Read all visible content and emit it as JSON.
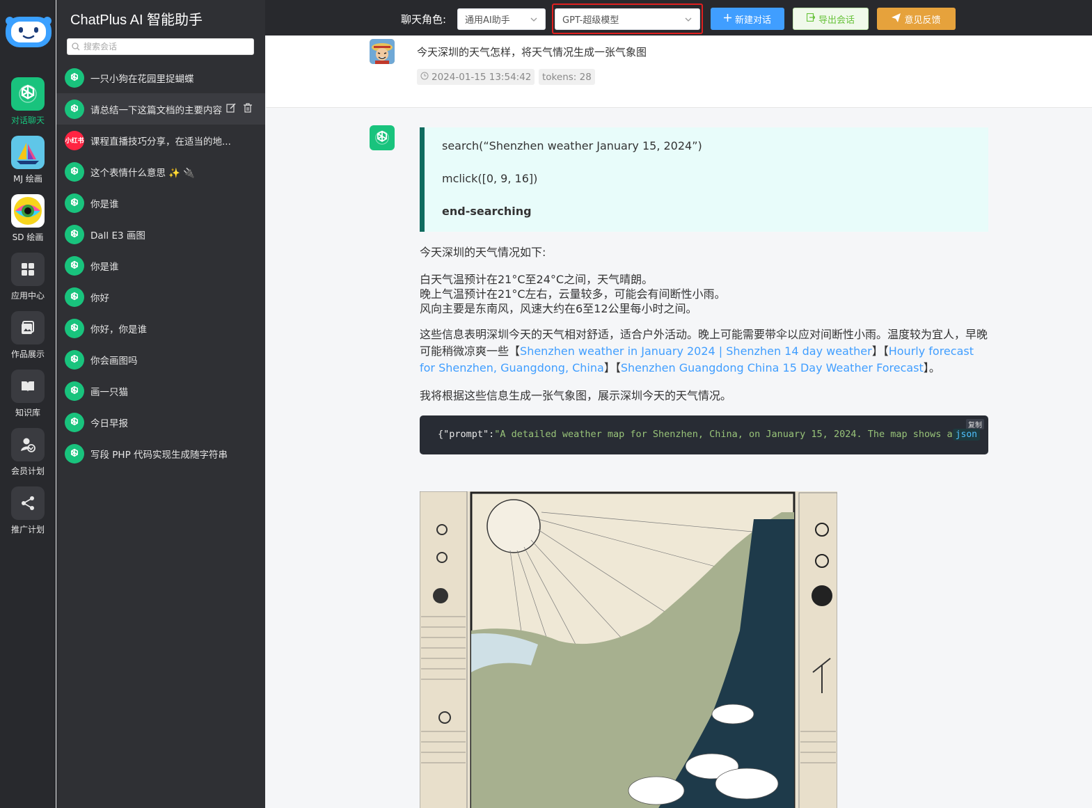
{
  "app": {
    "title": "ChatPlus AI 智能助手"
  },
  "rail": {
    "items": [
      {
        "label": "对话聊天",
        "icon": "openai-icon"
      },
      {
        "label": "MJ 绘画",
        "icon": "sailboat-icon"
      },
      {
        "label": "SD 绘画",
        "icon": "eye-art-icon"
      },
      {
        "label": "应用中心",
        "icon": "grid-icon"
      },
      {
        "label": "作品展示",
        "icon": "gallery-icon"
      },
      {
        "label": "知识库",
        "icon": "book-icon"
      },
      {
        "label": "会员计划",
        "icon": "member-icon"
      },
      {
        "label": "推广计划",
        "icon": "share-icon"
      }
    ]
  },
  "search": {
    "placeholder": "搜索会话"
  },
  "conversations": [
    {
      "title": "一只小狗在花园里捉蝴蝶"
    },
    {
      "title": "请总结一下这篇文档的主要内容",
      "active": true
    },
    {
      "title": "课程直播技巧分享，在适当的地...",
      "icon_text": "小红书"
    },
    {
      "title": "这个表情什么意思 ✨ 🔌"
    },
    {
      "title": "你是谁"
    },
    {
      "title": "Dall E3 画图"
    },
    {
      "title": "你是谁"
    },
    {
      "title": "你好"
    },
    {
      "title": "你好，你是谁"
    },
    {
      "title": "你会画图吗"
    },
    {
      "title": "画一只猫"
    },
    {
      "title": "今日早报"
    },
    {
      "title": "写段 PHP 代码实现生成随字符串"
    }
  ],
  "topbar": {
    "role_label": "聊天角色:",
    "role_value": "通用AI助手",
    "model_value": "GPT-超级模型",
    "new_chat": "新建对话",
    "export": "导出会话",
    "feedback": "意见反馈"
  },
  "message_user": {
    "text": "今天深圳的天气怎样，将天气情况生成一张气象图",
    "time": "2024-01-15 13:54:42",
    "tokens": "tokens: 28"
  },
  "message_ai": {
    "quote": [
      "search(“Shenzhen weather January 15, 2024”)",
      "mclick([0, 9, 16])",
      "end-searching"
    ],
    "intro": "今天深圳的天气情况如下:",
    "lines": [
      "白天气温预计在21°C至24°C之间，天气晴朗。",
      "晚上气温预计在21°C左右，云量较多，可能会有间断性小雨。",
      "风向主要是东南风，风速大约在6至12公里每小时之间。"
    ],
    "summary_text": "这些信息表明深圳今天的天气相对舒适，适合户外活动。晚上可能需要带伞以应对间断性小雨。温度较为宜人，早晚可能稍微凉爽一些",
    "link1": "Shenzhen weather in January 2024 | Shenzhen 14 day weather",
    "link2": "Hourly forecast for Shenzhen, Guangdong, China",
    "link3": "Shenzhen Guangdong China 15 Day Weather Forecast",
    "bracket_open": "【",
    "bracket_close": "】",
    "end_mark": "。",
    "plan": "我将根据这些信息生成一张气象图，展示深圳今天的天气情况。",
    "code_prefix": "{\"prompt\":",
    "code_string": "\"A detailed weather map for Shenzhen, China, on January 15, 2024. The map shows a s",
    "code_lang": "json",
    "copy_label": "复制"
  },
  "colors": {
    "accent_green": "#19c37d",
    "primary_blue": "#409eff",
    "warning_orange": "#e6a23c",
    "highlight_red": "#e02020"
  }
}
